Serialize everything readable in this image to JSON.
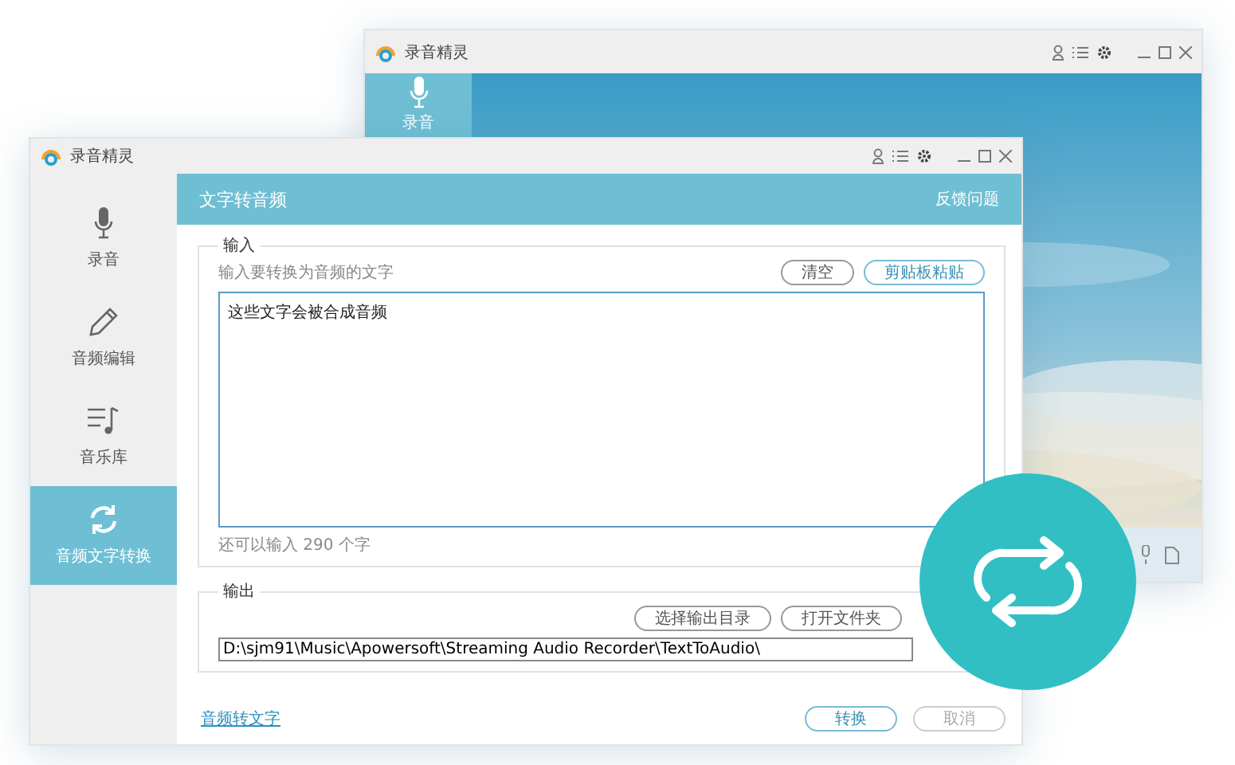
{
  "back_window": {
    "title": "录音精灵",
    "sidebar": {
      "items": [
        {
          "label": "录音",
          "selected": true
        }
      ]
    }
  },
  "window": {
    "title": "录音精灵",
    "sidebar": {
      "items": [
        {
          "label": "录音",
          "kind": "mic",
          "selected": false
        },
        {
          "label": "音频编辑",
          "kind": "pencil",
          "selected": false
        },
        {
          "label": "音乐库",
          "kind": "music",
          "selected": false
        },
        {
          "label": "音频文字转换",
          "kind": "convert",
          "selected": true
        }
      ]
    },
    "header": {
      "title": "文字转音频",
      "link": "反馈问题"
    },
    "input": {
      "legend": "输入",
      "hint": "输入要转换为音频的文字",
      "buttons": [
        {
          "label": "清空",
          "primary": false
        },
        {
          "label": "剪贴板粘贴",
          "primary": true
        }
      ],
      "value": "这些文字会被合成音频",
      "counter": "还可以输入 290 个字"
    },
    "output": {
      "legend": "输出",
      "buttons": [
        "选择输出目录",
        "打开文件夹"
      ],
      "path": "D:\\sjm91\\Music\\Apowersoft\\Streaming Audio Recorder\\TextToAudio\\"
    },
    "footer": {
      "link": "音频转文字",
      "buttons": [
        {
          "label": "转换",
          "disabled": false
        },
        {
          "label": "取消",
          "disabled": true
        }
      ]
    }
  }
}
